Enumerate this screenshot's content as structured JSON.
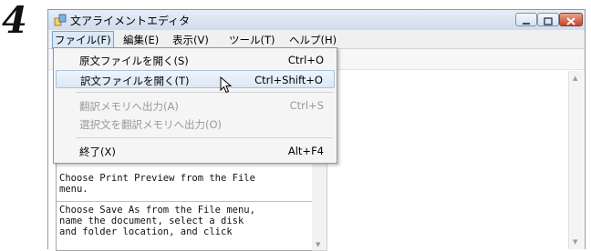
{
  "step_number": "4",
  "window": {
    "title": "文アライメントエディタ"
  },
  "menubar": {
    "items": [
      {
        "label": "ファイル(F)"
      },
      {
        "label": "編集(E)"
      },
      {
        "label": "表示(V)"
      },
      {
        "label": "ツール(T)"
      },
      {
        "label": "ヘルプ(H)"
      }
    ]
  },
  "file_menu": {
    "items": [
      {
        "label": "原文ファイルを開く(S)",
        "shortcut": "Ctrl+O",
        "enabled": true
      },
      {
        "label": "訳文ファイルを開く(T)",
        "shortcut": "Ctrl+Shift+O",
        "enabled": true,
        "highlighted": true
      },
      {
        "label": "翻訳メモリへ出力(A)",
        "shortcut": "Ctrl+S",
        "enabled": false
      },
      {
        "label": "選択文を翻訳メモリへ出力(O)",
        "shortcut": "",
        "enabled": false
      },
      {
        "label": "終了(X)",
        "shortcut": "Alt+F4",
        "enabled": true
      }
    ]
  },
  "segments": [
    {
      "text": "Choose Print Preview from the File\nmenu."
    },
    {
      "text": "Choose Save As from the File menu,\nname the document, select a disk\nand folder location, and click"
    }
  ],
  "colors": {
    "highlight": "#dce8f5",
    "disabled_text": "#9a9a9a",
    "close_button": "#c6452a"
  }
}
